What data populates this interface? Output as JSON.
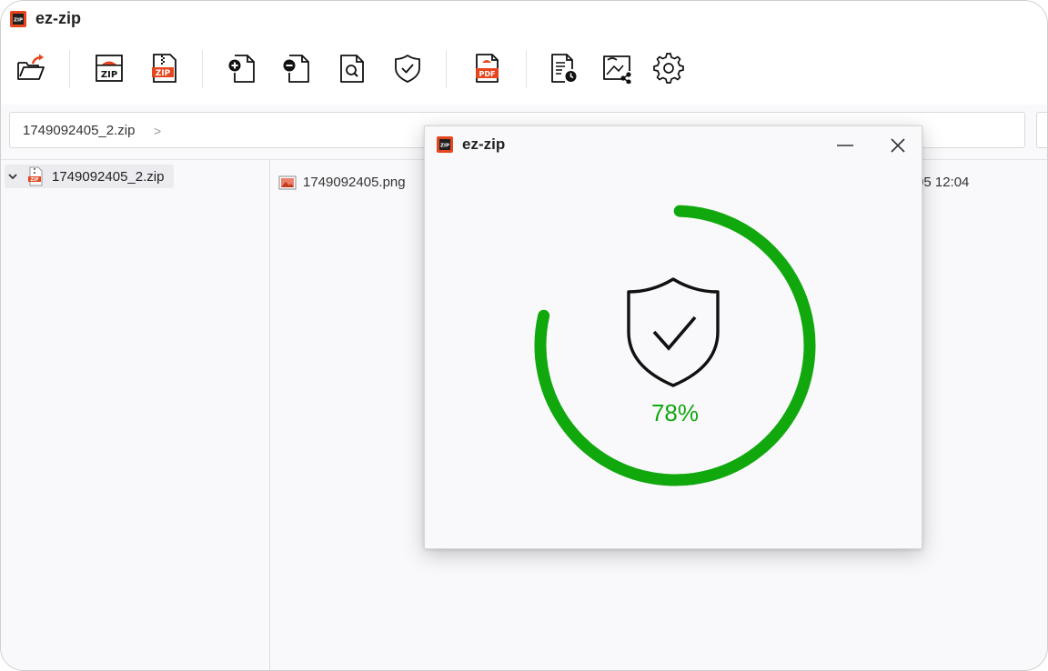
{
  "app": {
    "title": "ez-zip"
  },
  "toolbar": {
    "buttons": [
      {
        "name": "open",
        "icon": "folder-open-icon"
      },
      {
        "name": "compress-zip",
        "icon": "zip-file-icon"
      },
      {
        "name": "extract-zip",
        "icon": "zip-extract-icon"
      },
      {
        "name": "add-file",
        "icon": "file-add-icon"
      },
      {
        "name": "remove-file",
        "icon": "file-remove-icon"
      },
      {
        "name": "view-file",
        "icon": "file-search-icon"
      },
      {
        "name": "test-archive",
        "icon": "shield-check-icon"
      },
      {
        "name": "convert-pdf",
        "icon": "pdf-file-icon"
      },
      {
        "name": "history",
        "icon": "file-clock-icon"
      },
      {
        "name": "share",
        "icon": "share-icon"
      },
      {
        "name": "settings",
        "icon": "gear-icon"
      }
    ]
  },
  "pathbar": {
    "path": "1749092405_2.zip",
    "separator": ">"
  },
  "tree": {
    "root_label": "1749092405_2.zip"
  },
  "files": [
    {
      "name": "1749092405.png",
      "date_fragment": "-05 12:04"
    }
  ],
  "dialog": {
    "title": "ez-zip",
    "progress_percent": 78,
    "progress_text": "78%",
    "accent_color": "#11a80e"
  }
}
